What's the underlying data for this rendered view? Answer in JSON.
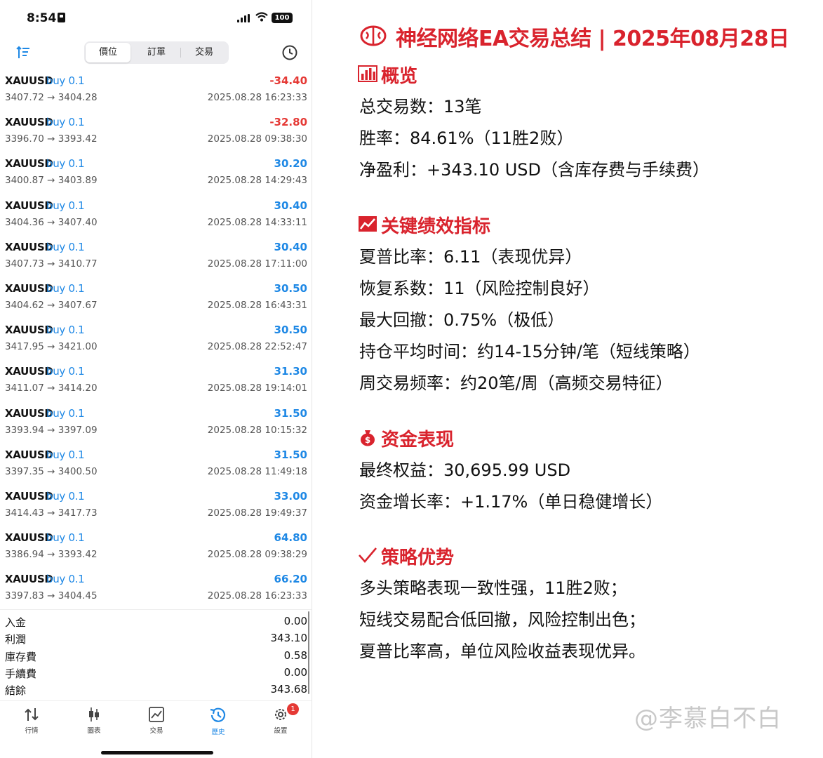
{
  "status_bar": {
    "time": "8:54",
    "battery": "100"
  },
  "tabs": {
    "items": [
      "價位",
      "訂單",
      "交易"
    ],
    "active": 0
  },
  "trades": [
    {
      "symbol": "XAUUSD",
      "side": "buy 0.1",
      "pl": "-34.40",
      "prices": "3407.72 → 3404.28",
      "time": "2025.08.28 16:23:33"
    },
    {
      "symbol": "XAUUSD",
      "side": "buy 0.1",
      "pl": "-32.80",
      "prices": "3396.70 → 3393.42",
      "time": "2025.08.28 09:38:30"
    },
    {
      "symbol": "XAUUSD",
      "side": "buy 0.1",
      "pl": "30.20",
      "prices": "3400.87 → 3403.89",
      "time": "2025.08.28 14:29:43"
    },
    {
      "symbol": "XAUUSD",
      "side": "buy 0.1",
      "pl": "30.40",
      "prices": "3404.36 → 3407.40",
      "time": "2025.08.28 14:33:11"
    },
    {
      "symbol": "XAUUSD",
      "side": "buy 0.1",
      "pl": "30.40",
      "prices": "3407.73 → 3410.77",
      "time": "2025.08.28 17:11:00"
    },
    {
      "symbol": "XAUUSD",
      "side": "buy 0.1",
      "pl": "30.50",
      "prices": "3404.62 → 3407.67",
      "time": "2025.08.28 16:43:31"
    },
    {
      "symbol": "XAUUSD",
      "side": "buy 0.1",
      "pl": "30.50",
      "prices": "3417.95 → 3421.00",
      "time": "2025.08.28 22:52:47"
    },
    {
      "symbol": "XAUUSD",
      "side": "buy 0.1",
      "pl": "31.30",
      "prices": "3411.07 → 3414.20",
      "time": "2025.08.28 19:14:01"
    },
    {
      "symbol": "XAUUSD",
      "side": "buy 0.1",
      "pl": "31.50",
      "prices": "3393.94 → 3397.09",
      "time": "2025.08.28 10:15:32"
    },
    {
      "symbol": "XAUUSD",
      "side": "buy 0.1",
      "pl": "31.50",
      "prices": "3397.35 → 3400.50",
      "time": "2025.08.28 11:49:18"
    },
    {
      "symbol": "XAUUSD",
      "side": "buy 0.1",
      "pl": "33.00",
      "prices": "3414.43 → 3417.73",
      "time": "2025.08.28 19:49:37"
    },
    {
      "symbol": "XAUUSD",
      "side": "buy 0.1",
      "pl": "64.80",
      "prices": "3386.94 → 3393.42",
      "time": "2025.08.28 09:38:29"
    },
    {
      "symbol": "XAUUSD",
      "side": "buy 0.1",
      "pl": "66.20",
      "prices": "3397.83 → 3404.45",
      "time": "2025.08.28 16:23:33"
    }
  ],
  "summary": [
    {
      "label": "入金",
      "value": "0.00"
    },
    {
      "label": "利潤",
      "value": "343.10"
    },
    {
      "label": "庫存費",
      "value": "0.58"
    },
    {
      "label": "手續費",
      "value": "0.00"
    },
    {
      "label": "結餘",
      "value": "343.68"
    }
  ],
  "tabbar": {
    "items": [
      "行情",
      "圖表",
      "交易",
      "歷史",
      "設置"
    ],
    "active": 3,
    "badge": "1"
  },
  "report": {
    "title": "神经网络EA交易总结 | 2025年08月28日",
    "sections": [
      {
        "icon": "bar-chart-icon",
        "title": "概览",
        "lines": [
          "总交易数：13笔",
          "胜率：84.61%（11胜2败）",
          "净盈利：+343.10 USD（含库存费与手续费）"
        ]
      },
      {
        "icon": "trend-chart-icon",
        "title": "关键绩效指标",
        "lines": [
          "夏普比率：6.11（表现优异）",
          "恢复系数：11（风险控制良好）",
          "最大回撤：0.75%（极低）",
          "持仓平均时间：约14-15分钟/笔（短线策略）",
          "周交易频率：约20笔/周（高频交易特征）"
        ]
      },
      {
        "icon": "money-bag-icon",
        "title": "资金表现",
        "lines": [
          "最终权益：30,695.99 USD",
          "资金增长率：+1.17%（单日稳健增长）"
        ]
      },
      {
        "icon": "check-mark-icon",
        "title": "策略优势",
        "lines": [
          "多头策略表现一致性强，11胜2败；",
          "短线交易配合低回撤，风险控制出色；",
          "夏普比率高，单位风险收益表现优异。"
        ]
      }
    ]
  },
  "watermark": "@李慕白不白",
  "colors": {
    "accent_red": "#d9232d",
    "profit_blue": "#1e88e5",
    "loss_red": "#e53935"
  }
}
